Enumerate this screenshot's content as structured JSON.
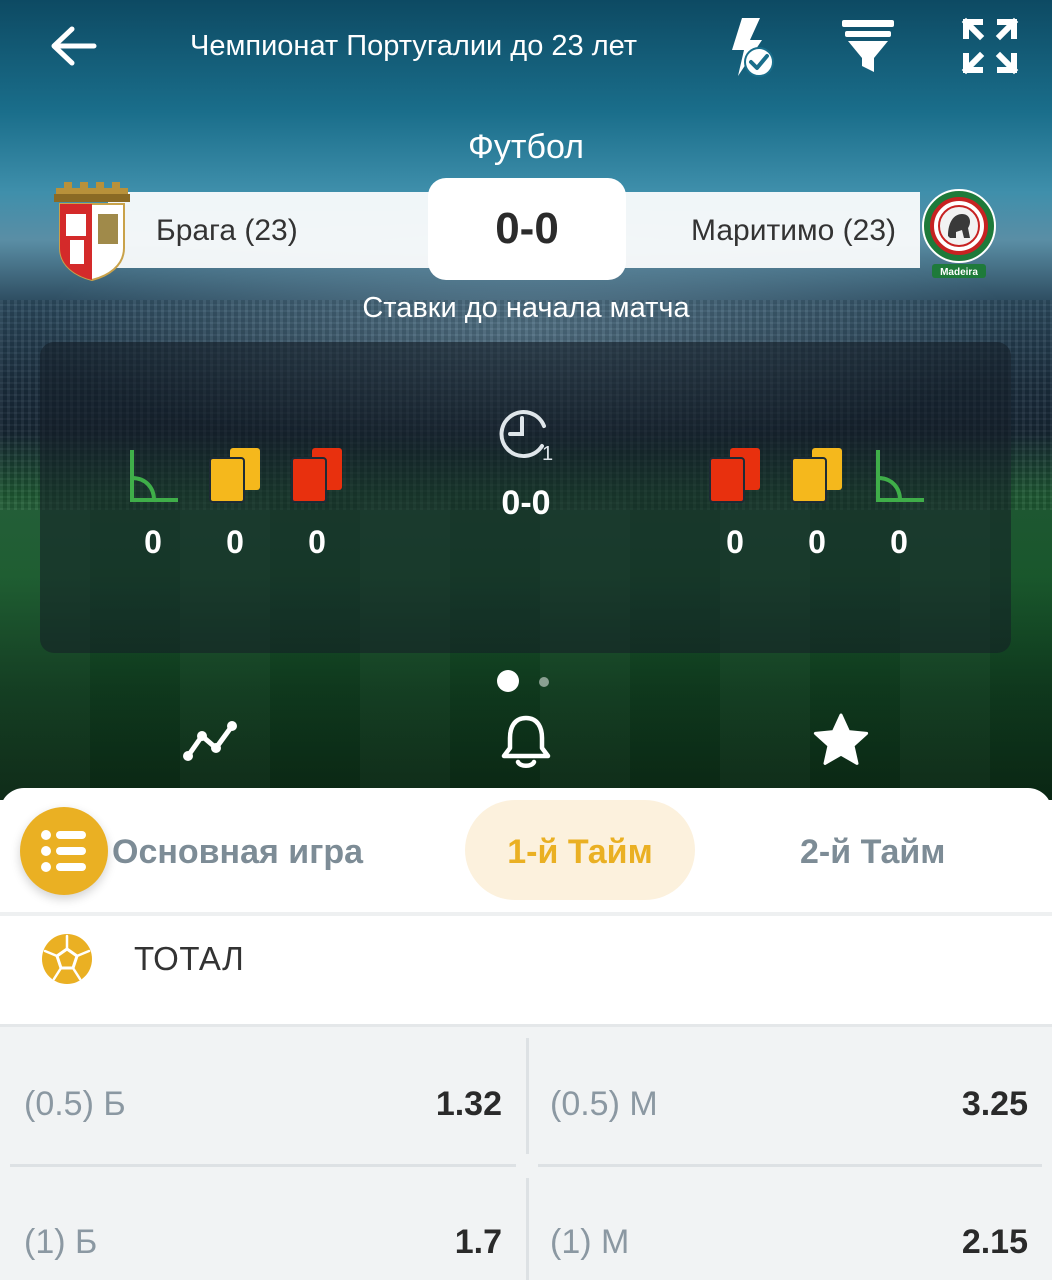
{
  "header": {
    "title": "Чемпионат Португалии до 23 лет",
    "icons": [
      "back-arrow-icon",
      "flash-check-icon",
      "filter-icon",
      "expand-icon"
    ]
  },
  "match": {
    "sport": "Футбол",
    "home_team": "Брага (23)",
    "away_team": "Маритимо (23)",
    "score": "0-0",
    "status": "Ставки до начала матча",
    "period_score": "0-0",
    "period_icon_label": "1",
    "home_stats": {
      "corners": "0",
      "yellow_cards": "0",
      "red_cards": "0"
    },
    "away_stats": {
      "red_cards": "0",
      "yellow_cards": "0",
      "corners": "0"
    },
    "away_crest_text": "Madeira"
  },
  "pager": {
    "pages": 2,
    "active": 1
  },
  "actions": [
    "stats-chart-icon",
    "bell-icon",
    "star-icon"
  ],
  "tabs": [
    {
      "label": "Основная игра",
      "active": false
    },
    {
      "label": "1-й Тайм",
      "active": true
    },
    {
      "label": "2-й Тайм",
      "active": false
    }
  ],
  "market": {
    "title": "ТОТАЛ",
    "outcomes": [
      {
        "label": "(0.5) Б",
        "odds": "1.32"
      },
      {
        "label": "(0.5) М",
        "odds": "3.25"
      },
      {
        "label": "(1) Б",
        "odds": "1.7"
      },
      {
        "label": "(1) М",
        "odds": "2.15"
      }
    ]
  },
  "colors": {
    "accent": "#EAB023",
    "corner_green": "#4CAF50",
    "yellow_card": "#F5B81C",
    "red_card": "#E8300E"
  }
}
